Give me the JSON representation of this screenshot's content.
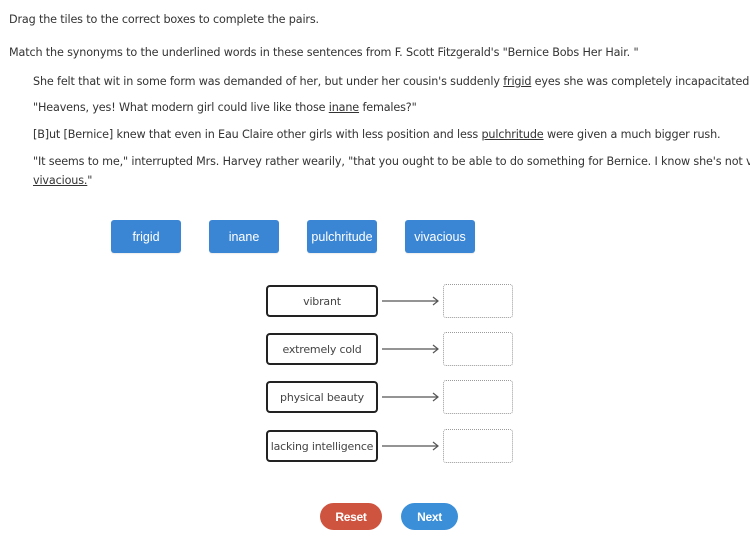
{
  "instruction": "Drag the tiles to the correct boxes to complete the pairs.",
  "prompt": "Match the synonyms to the underlined words in these sentences from F. Scott Fitzgerald's \"Bernice Bobs Her Hair. \"",
  "sentences": [
    {
      "before": "She felt that wit in some form was demanded of her, but under her cousin's suddenly ",
      "word": "frigid",
      "after": " eyes she was completely incapacitated."
    },
    {
      "before": "\"Heavens, yes! What modern girl could live like those ",
      "word": "inane",
      "after": " females?\""
    },
    {
      "before": "[B]ut [Bernice] knew that even in Eau Claire other girls with less position and less ",
      "word": "pulchritude",
      "after": " were given a much bigger rush."
    },
    {
      "before": "\"It seems to me,\" interrupted Mrs. Harvey rather wearily, \"that you ought to be able to do something for Bernice. I know she's not very",
      "word": "vivacious.",
      "after": "\""
    }
  ],
  "tiles": [
    "frigid",
    "inane",
    "pulchritude",
    "vivacious"
  ],
  "pairs": [
    {
      "term": "vibrant",
      "answer": ""
    },
    {
      "term": "extremely cold",
      "answer": ""
    },
    {
      "term": "physical beauty",
      "answer": ""
    },
    {
      "term": "lacking intelligence",
      "answer": ""
    }
  ],
  "buttons": {
    "reset": "Reset",
    "next": "Next"
  },
  "colors": {
    "tile": "#3b86d4",
    "reset": "#cf5440",
    "next": "#3a8fd8"
  }
}
